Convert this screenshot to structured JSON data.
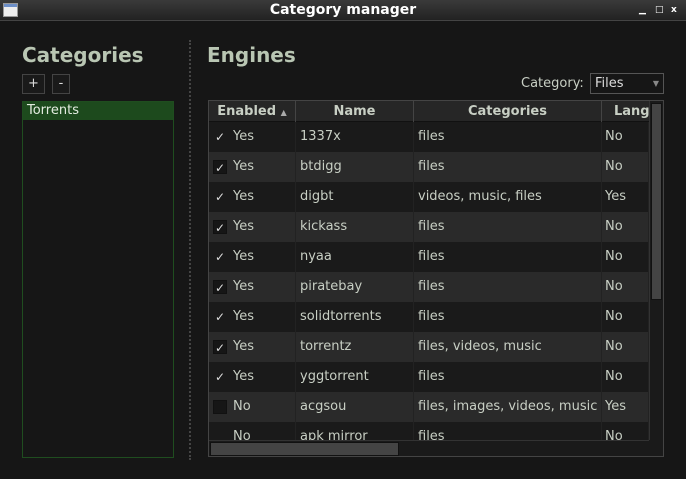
{
  "window": {
    "title": "Category manager",
    "minimize": "▁",
    "maximize": "□",
    "close": "x"
  },
  "categories": {
    "heading": "Categories",
    "add_label": "+",
    "remove_label": "-",
    "items": [
      "Torrents"
    ]
  },
  "engines": {
    "heading": "Engines",
    "category_label": "Category:",
    "category_value": "Files",
    "columns": [
      "Enabled",
      "Name",
      "Categories",
      "Lang"
    ],
    "rows": [
      {
        "check": "✓",
        "enabled": "Yes",
        "name": "1337x",
        "categories": "files",
        "lang": "No"
      },
      {
        "check": "✓",
        "enabled": "Yes",
        "name": "btdigg",
        "categories": "files",
        "lang": "No"
      },
      {
        "check": "✓",
        "enabled": "Yes",
        "name": "digbt",
        "categories": "videos, music, files",
        "lang": "Yes"
      },
      {
        "check": "✓",
        "enabled": "Yes",
        "name": "kickass",
        "categories": "files",
        "lang": "No"
      },
      {
        "check": "✓",
        "enabled": "Yes",
        "name": "nyaa",
        "categories": "files",
        "lang": "No"
      },
      {
        "check": "✓",
        "enabled": "Yes",
        "name": "piratebay",
        "categories": "files",
        "lang": "No"
      },
      {
        "check": "✓",
        "enabled": "Yes",
        "name": "solidtorrents",
        "categories": "files",
        "lang": "No"
      },
      {
        "check": "✓",
        "enabled": "Yes",
        "name": "torrentz",
        "categories": "files, videos, music",
        "lang": "No"
      },
      {
        "check": "✓",
        "enabled": "Yes",
        "name": "yggtorrent",
        "categories": "files",
        "lang": "No"
      },
      {
        "check": "",
        "enabled": "No",
        "name": "acgsou",
        "categories": "files, images, videos, music",
        "lang": "Yes"
      },
      {
        "check": "",
        "enabled": "No",
        "name": "apk mirror",
        "categories": "files",
        "lang": "No"
      }
    ]
  }
}
